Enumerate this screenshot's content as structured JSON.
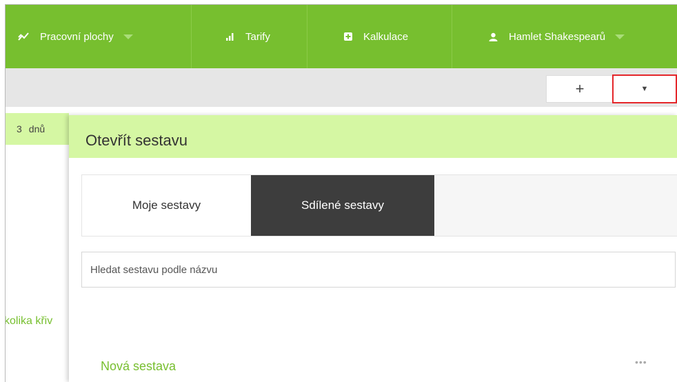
{
  "nav": {
    "workspaces": {
      "label": "Pracovní plochy",
      "icon": "trend-chart-icon"
    },
    "tariffs": {
      "label": "Tarify",
      "icon": "bar-chart-icon"
    },
    "calculations": {
      "label": "Kalkulace",
      "icon": "plus-square-icon"
    },
    "user": {
      "label": "Hamlet Shakespearů",
      "icon": "user-icon"
    }
  },
  "toolbar": {
    "add_label": "+",
    "dropdown_label": "▼"
  },
  "left": {
    "days_num": "3",
    "days_unit": "dnů",
    "link_text": "kolika křiv"
  },
  "dialog": {
    "title": "Otevřít sestavu",
    "tabs": [
      {
        "label": "Moje sestavy",
        "active": true
      },
      {
        "label": "Sdílené sestavy",
        "active": false
      }
    ],
    "search": {
      "placeholder": "Hledat sestavu podle názvu",
      "value": ""
    },
    "reports": [
      {
        "name": "Nová sestava",
        "menu": "•••"
      }
    ]
  },
  "colors": {
    "brand_green": "#77bf2f",
    "light_green": "#d5f7a3",
    "dark_tab": "#3d3d3d",
    "highlight_red": "#e4262a"
  }
}
